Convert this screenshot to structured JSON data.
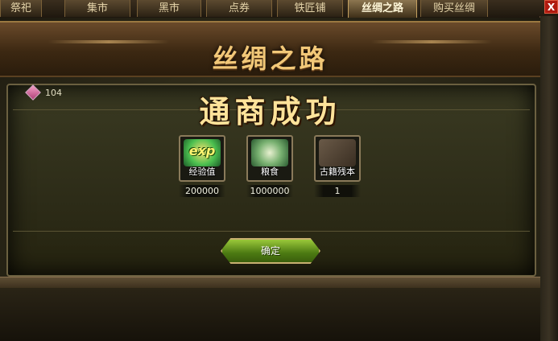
{
  "tabs": [
    {
      "label": "祭祀",
      "active": false
    },
    {
      "label": "集市",
      "active": false
    },
    {
      "label": "黑市",
      "active": false
    },
    {
      "label": "点券",
      "active": false
    },
    {
      "label": "铁匠铺",
      "active": false
    },
    {
      "label": "丝绸之路",
      "active": true
    },
    {
      "label": "购买丝绸",
      "active": false
    }
  ],
  "close_label": "X",
  "panel": {
    "title": "丝绸之路",
    "count": "104",
    "count_icon": "pink-gem-icon",
    "success_message": "通商成功"
  },
  "rewards": [
    {
      "icon": "exp-icon",
      "icon_text": "exp",
      "name": "经验值",
      "value": "200000"
    },
    {
      "icon": "grain-icon",
      "name": "粮食",
      "value": "1000000"
    },
    {
      "icon": "ancient-book-icon",
      "name": "古籍残本",
      "value": "1"
    }
  ],
  "confirm_label": "确定",
  "colors": {
    "title_gold": "#f2c878",
    "button_green": "#6a9a20",
    "close_red": "#b01a10"
  }
}
